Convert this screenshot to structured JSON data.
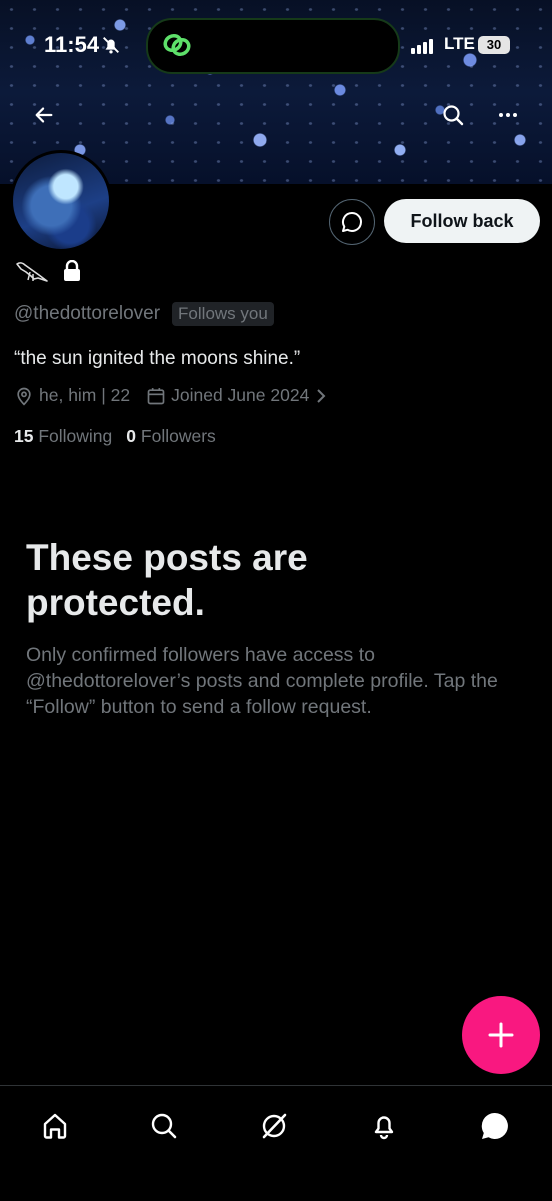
{
  "status_bar": {
    "time": "11:54",
    "network": "LTE",
    "battery": "30"
  },
  "header": {
    "back_icon": "arrow-left-icon",
    "search_icon": "search-icon",
    "more_icon": "more-icon"
  },
  "profile": {
    "handle": "@thedottorelover",
    "follows_you": "Follows you",
    "bio": "“the sun ignited the moons shine.”",
    "location": "he, him | 22",
    "joined": "Joined June 2024",
    "following_count": "15",
    "following_label": "Following",
    "followers_count": "0",
    "followers_label": "Followers",
    "follow_back_label": "Follow back"
  },
  "protected": {
    "title": "These posts are protected.",
    "body": "Only confirmed followers have access to @thedottorelover’s posts and complete profile. Tap the “Follow” button to send a follow request."
  },
  "colors": {
    "accent_fab": "#f91880",
    "background": "#000000",
    "muted_text": "#71767b"
  },
  "tabs": [
    "home-icon",
    "search-icon",
    "grok-icon",
    "notifications-icon",
    "messages-icon"
  ]
}
